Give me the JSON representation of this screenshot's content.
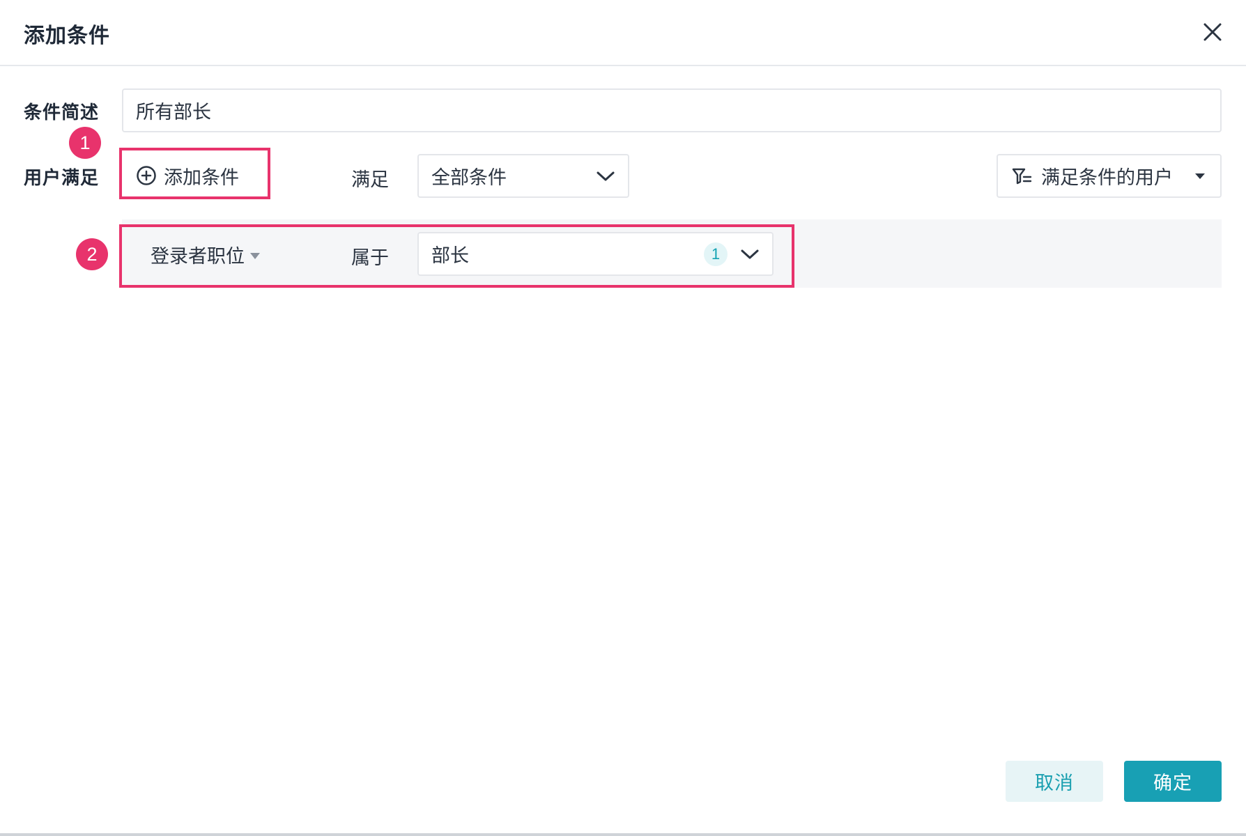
{
  "dialog": {
    "title": "添加条件",
    "close_icon": "close-icon"
  },
  "form": {
    "description_label": "条件简述",
    "description_value": "所有部长",
    "user_match_label": "用户满足",
    "add_condition_label": "添加条件",
    "add_condition_icon": "plus-circle-icon",
    "satisfy_label": "满足",
    "match_mode_value": "全部条件",
    "filter_button_label": "满足条件的用户",
    "filter_icon": "filter-list-icon"
  },
  "condition": {
    "field_label": "登录者职位",
    "operator_label": "属于",
    "value_label": "部长",
    "selected_count": "1"
  },
  "annotations": {
    "badge_1": "1",
    "badge_2": "2",
    "highlight_color": "#e8336c"
  },
  "footer": {
    "cancel_label": "取消",
    "ok_label": "确定"
  },
  "colors": {
    "accent": "#18a0b4",
    "accent_light": "#e7f4f6"
  }
}
